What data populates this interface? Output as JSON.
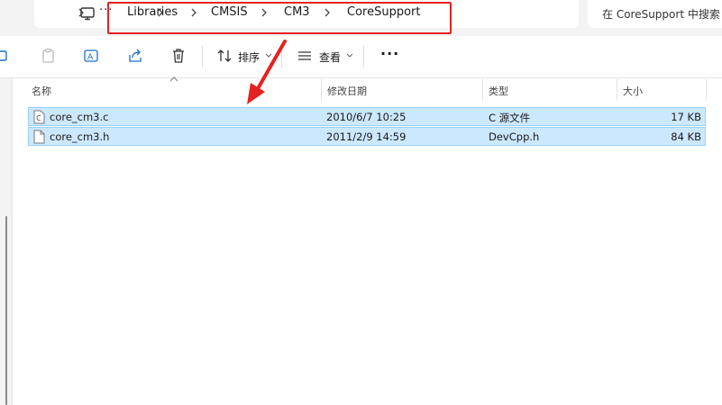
{
  "breadcrumb": {
    "ellipsis": "···",
    "items": [
      "Libraries",
      "CMSIS",
      "CM3",
      "CoreSupport"
    ]
  },
  "search": {
    "placeholder": "在 CoreSupport 中搜索"
  },
  "toolbar": {
    "sort_label": "排序",
    "view_label": "查看",
    "more_label": "···"
  },
  "columns": {
    "name": "名称",
    "modified": "修改日期",
    "type": "类型",
    "size": "大小"
  },
  "files": [
    {
      "name": "core_cm3.c",
      "modified": "2010/6/7 10:25",
      "type": "C 源文件",
      "size": "17 KB",
      "icon": "c-source-file-icon"
    },
    {
      "name": "core_cm3.h",
      "modified": "2011/2/9 14:59",
      "type": "DevCpp.h",
      "size": "84 KB",
      "icon": "file-icon"
    }
  ],
  "colors": {
    "selection": "#cce8ff",
    "selection_border": "#99d1ff",
    "annotation": "#e52222"
  }
}
